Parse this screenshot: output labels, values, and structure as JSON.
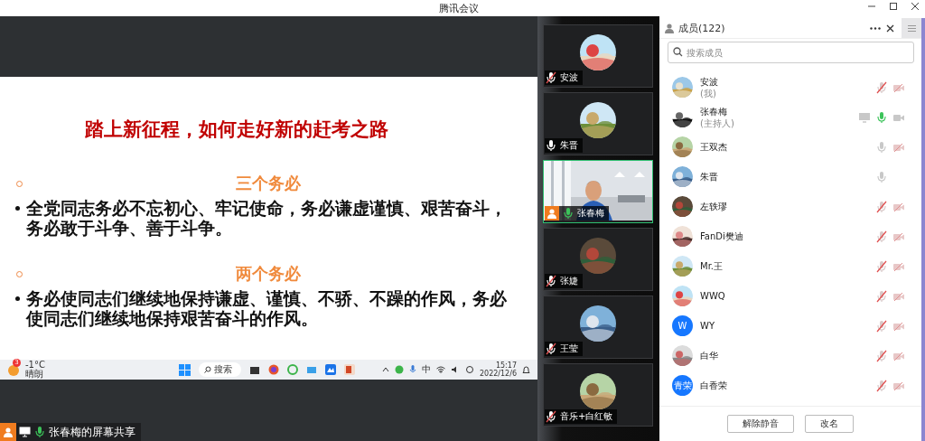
{
  "window": {
    "title": "腾讯会议"
  },
  "slide": {
    "title": "踏上新征程，如何走好新的赶考之路",
    "sections": [
      {
        "heading": "三个务必",
        "text": "全党同志务必不忘初心、牢记使命，务必谦虚谨慎、艰苦奋斗，务必敢于斗争、善于斗争。"
      },
      {
        "heading": "两个务必",
        "text": "务必使同志们继续地保持谦虚、谨慎、不骄、不躁的作风，务必使同志们继续地保持艰苦奋斗的作风。"
      }
    ]
  },
  "taskbar": {
    "weather_badge": "3",
    "temperature": "-1°C",
    "weather": "晴朗",
    "search_placeholder": "搜索",
    "ime": "中",
    "time": "15:17",
    "date": "2022/12/6"
  },
  "share_label": "张春梅的屏幕共享",
  "videos": [
    {
      "name": "安波",
      "muted": true,
      "speaking": false,
      "selected": false,
      "host": false,
      "kind": "avatar"
    },
    {
      "name": "朱晋",
      "muted": false,
      "speaking": false,
      "selected": false,
      "host": false,
      "kind": "avatar"
    },
    {
      "name": "张春梅",
      "speaking": true,
      "selected": true,
      "host": true,
      "kind": "camera"
    },
    {
      "name": "张婕",
      "muted": true,
      "speaking": false,
      "selected": false,
      "host": false,
      "kind": "avatar"
    },
    {
      "name": "王莹",
      "muted": true,
      "speaking": false,
      "selected": false,
      "host": false,
      "kind": "avatar"
    },
    {
      "name": "音乐+白红敏",
      "muted": true,
      "speaking": false,
      "selected": false,
      "host": false,
      "kind": "avatar"
    }
  ],
  "members": {
    "title": "成员(122)",
    "search_placeholder": "搜索成员",
    "items": [
      {
        "name": "安波",
        "note": "(我)",
        "screen": false,
        "muted": true,
        "speaking": false,
        "has_camera": true,
        "camera_off": true
      },
      {
        "name": "张春梅",
        "note": "(主持人)",
        "screen": true,
        "speaking": true,
        "has_camera": true,
        "camera_off": false
      },
      {
        "name": "王双杰",
        "screen": false,
        "muted": false,
        "speaking": false,
        "has_camera": true,
        "camera_off": true
      },
      {
        "name": "朱晋",
        "screen": false,
        "muted": false,
        "speaking": false,
        "has_camera": false
      },
      {
        "name": "左轶璆",
        "screen": false,
        "muted": true,
        "speaking": false,
        "has_camera": true,
        "camera_off": true
      },
      {
        "name": "FanDi樊迪",
        "screen": false,
        "muted": true,
        "speaking": false,
        "has_camera": true,
        "camera_off": true
      },
      {
        "name": "Mr.王",
        "screen": false,
        "muted": true,
        "speaking": false,
        "has_camera": true,
        "camera_off": true
      },
      {
        "name": "WWQ",
        "screen": false,
        "muted": true,
        "speaking": false,
        "has_camera": true,
        "camera_off": true
      },
      {
        "name": "WY",
        "avatar_text": "W",
        "color": "#1677ff",
        "screen": false,
        "muted": true,
        "speaking": false,
        "has_camera": true,
        "camera_off": true
      },
      {
        "name": "白华",
        "screen": false,
        "muted": true,
        "speaking": false,
        "has_camera": true,
        "camera_off": true
      },
      {
        "name": "白香荣",
        "avatar_text": "青荣",
        "color": "#1677ff",
        "screen": false,
        "muted": true,
        "speaking": false,
        "has_camera": true,
        "camera_off": true
      }
    ],
    "buttons": [
      "解除静音",
      "改名"
    ]
  }
}
